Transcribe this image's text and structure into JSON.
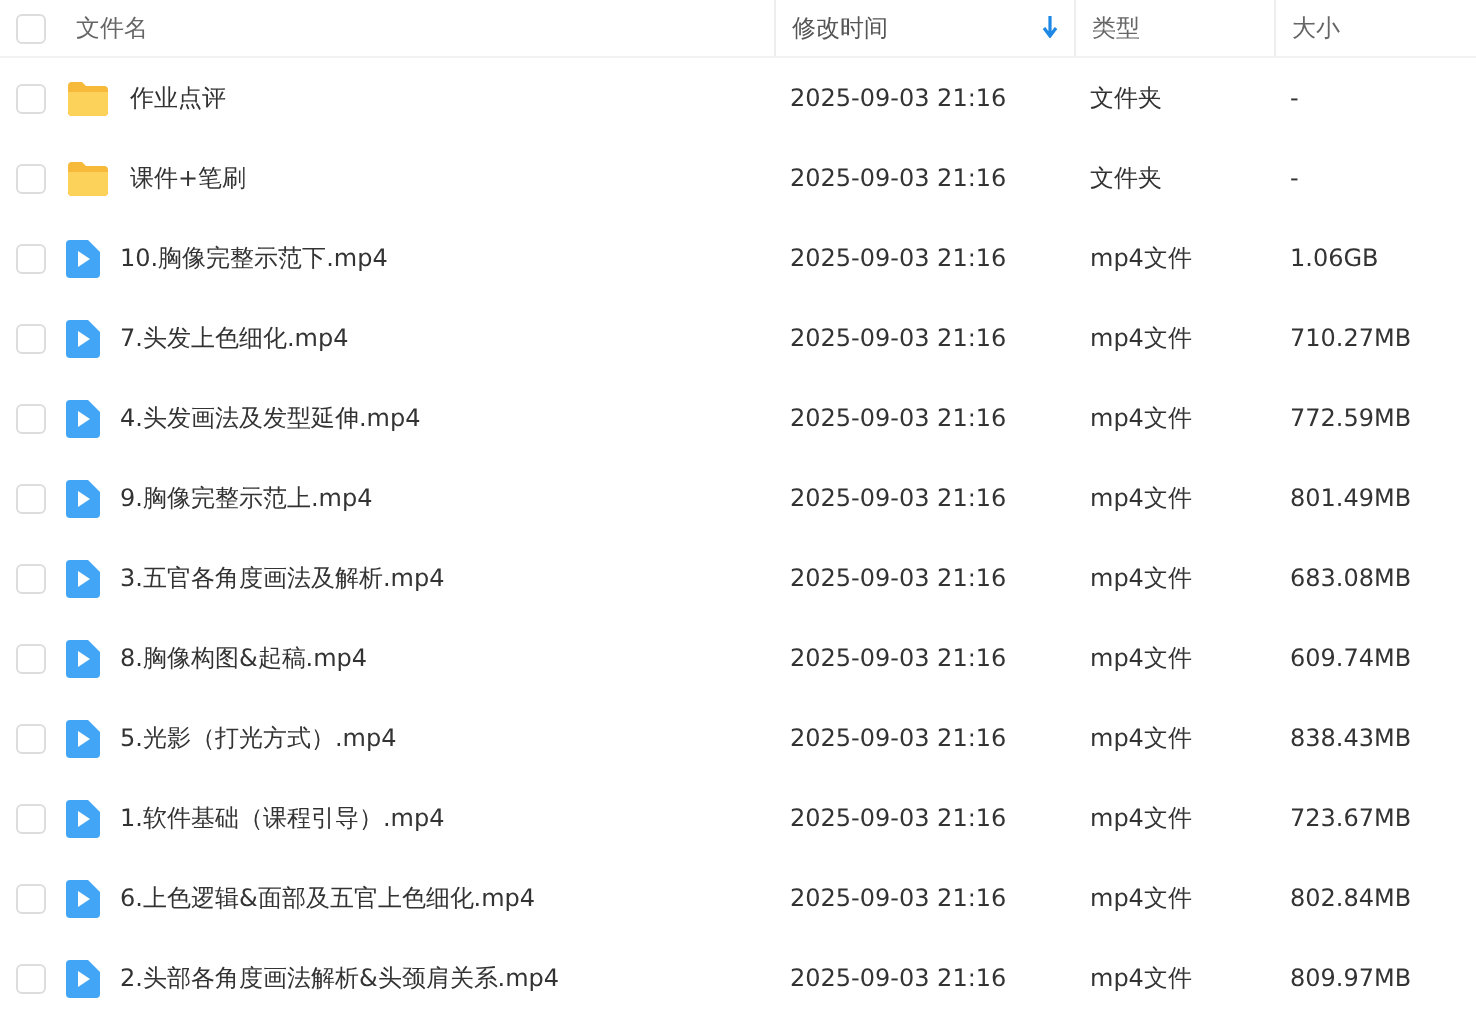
{
  "header": {
    "all_checked": false,
    "columns": [
      {
        "label": "文件名",
        "sorted": false
      },
      {
        "label": "修改时间",
        "sorted": true
      },
      {
        "label": "类型",
        "sorted": false
      },
      {
        "label": "大小",
        "sorted": false
      }
    ]
  },
  "files": [
    {
      "kind": "folder",
      "checked": false,
      "name": "作业点评",
      "modified": "2025-09-03 21:16",
      "type": "文件夹",
      "size": "-"
    },
    {
      "kind": "folder",
      "checked": false,
      "name": "课件+笔刷",
      "modified": "2025-09-03 21:16",
      "type": "文件夹",
      "size": "-"
    },
    {
      "kind": "video",
      "checked": false,
      "name": "10.胸像完整示范下.mp4",
      "modified": "2025-09-03 21:16",
      "type": "mp4文件",
      "size": "1.06GB"
    },
    {
      "kind": "video",
      "checked": false,
      "name": "7.头发上色细化.mp4",
      "modified": "2025-09-03 21:16",
      "type": "mp4文件",
      "size": "710.27MB"
    },
    {
      "kind": "video",
      "checked": false,
      "name": "4.头发画法及发型延伸.mp4",
      "modified": "2025-09-03 21:16",
      "type": "mp4文件",
      "size": "772.59MB"
    },
    {
      "kind": "video",
      "checked": false,
      "name": "9.胸像完整示范上.mp4",
      "modified": "2025-09-03 21:16",
      "type": "mp4文件",
      "size": "801.49MB"
    },
    {
      "kind": "video",
      "checked": false,
      "name": "3.五官各角度画法及解析.mp4",
      "modified": "2025-09-03 21:16",
      "type": "mp4文件",
      "size": "683.08MB"
    },
    {
      "kind": "video",
      "checked": false,
      "name": "8.胸像构图&起稿.mp4",
      "modified": "2025-09-03 21:16",
      "type": "mp4文件",
      "size": "609.74MB"
    },
    {
      "kind": "video",
      "checked": false,
      "name": "5.光影（打光方式）.mp4",
      "modified": "2025-09-03 21:16",
      "type": "mp4文件",
      "size": "838.43MB"
    },
    {
      "kind": "video",
      "checked": false,
      "name": "1.软件基础（课程引导）.mp4",
      "modified": "2025-09-03 21:16",
      "type": "mp4文件",
      "size": "723.67MB"
    },
    {
      "kind": "video",
      "checked": false,
      "name": "6.上色逻辑&面部及五官上色细化.mp4",
      "modified": "2025-09-03 21:16",
      "type": "mp4文件",
      "size": "802.84MB"
    },
    {
      "kind": "video",
      "checked": false,
      "name": "2.头部各角度画法解析&头颈肩关系.mp4",
      "modified": "2025-09-03 21:16",
      "type": "mp4文件",
      "size": "809.97MB"
    }
  ]
}
